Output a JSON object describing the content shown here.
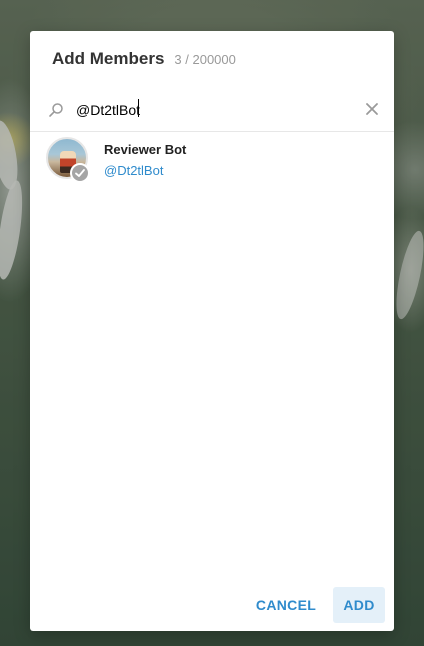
{
  "dialog": {
    "title": "Add Members",
    "counter": "3 / 200000"
  },
  "search": {
    "value": "@Dt2tlBot",
    "icon": "search-icon",
    "clear_icon": "close-icon"
  },
  "results": [
    {
      "name": "Reviewer Bot",
      "username": "@Dt2tlBot",
      "selected": true,
      "badge_icon": "check-icon"
    }
  ],
  "footer": {
    "cancel_label": "CANCEL",
    "add_label": "ADD"
  },
  "colors": {
    "accent": "#2f8bcc",
    "badge": "#a5a5a5"
  }
}
